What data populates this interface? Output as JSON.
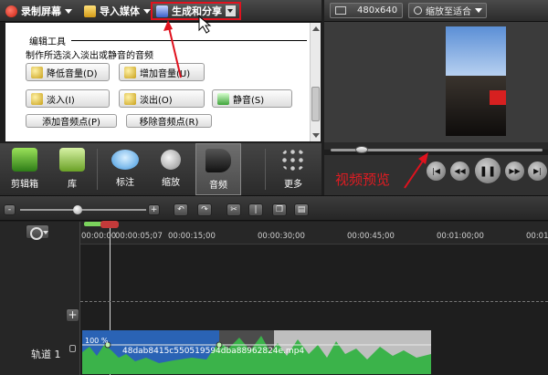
{
  "toolbar": {
    "record_screen": "录制屏幕",
    "import_media": "导入媒体",
    "produce_share": "生成和分享"
  },
  "preview_toolbar": {
    "size": "480x640",
    "zoom_fit": "缩放至适合"
  },
  "edit_panel": {
    "section_title": "编辑工具",
    "description": "制作所选淡入淡出或静音的音频",
    "buttons": {
      "volume_down": "降低音量(D)",
      "volume_up": "增加音量(U)",
      "fade_in": "淡入(I)",
      "fade_out": "淡出(O)",
      "mute": "静音(S)",
      "add_audio_point": "添加音频点(P)",
      "remove_audio_point": "移除音频点(R)"
    }
  },
  "tool_tabs": [
    {
      "label": "剪辑箱",
      "icon": "film-strip-icon"
    },
    {
      "label": "库",
      "icon": "library-folder-icon"
    },
    {
      "label": "标注",
      "icon": "speech-bubble-icon"
    },
    {
      "label": "缩放",
      "icon": "magnifier-icon"
    },
    {
      "label": "音频",
      "icon": "speaker-icon",
      "active": true
    },
    {
      "label": "更多",
      "icon": "dots-circle-icon"
    }
  ],
  "preview": {
    "overlay_label": "视频预览",
    "playback_icons": [
      "skip-back-icon",
      "rewind-icon",
      "play-pause-icon",
      "fast-forward-icon",
      "skip-forward-icon"
    ]
  },
  "timeline": {
    "ruler_labels": [
      "00:00:00",
      "00:00:05;07",
      "00:00:15;00",
      "00:00:30;00",
      "00:00:45;00",
      "00:01:00;00",
      "00:01"
    ],
    "track_label": "轨道 1",
    "add_track_symbol": "+",
    "clip": {
      "volume": "100 %",
      "filename": "48dab8415c550519594dba88962824e.mp4"
    }
  },
  "colors": {
    "highlight_red": "#e0121e",
    "clip_blue": "#2a63b5",
    "audio_green": "#3bb34a"
  }
}
